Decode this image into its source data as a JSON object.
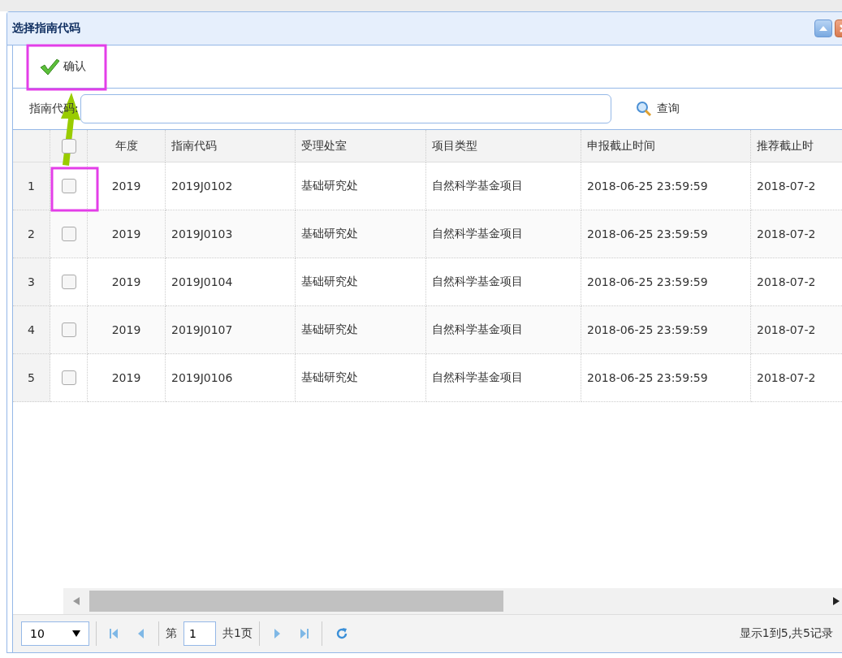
{
  "window": {
    "title": "选择指南代码"
  },
  "toolbar": {
    "confirm": "确认"
  },
  "search": {
    "label": "指南代码:",
    "button": "查询"
  },
  "table": {
    "columns": [
      "年度",
      "指南代码",
      "受理处室",
      "项目类型",
      "申报截止时间",
      "推荐截止时"
    ],
    "header_checked": false,
    "rows": [
      {
        "number": "1",
        "checked": false,
        "cells": [
          "2019",
          "2019J0102",
          "基础研究处",
          "自然科学基金项目",
          "2018-06-25 23:59:59",
          "2018-07-2"
        ]
      },
      {
        "number": "2",
        "checked": false,
        "cells": [
          "2019",
          "2019J0103",
          "基础研究处",
          "自然科学基金项目",
          "2018-06-25 23:59:59",
          "2018-07-2"
        ]
      },
      {
        "number": "3",
        "checked": false,
        "cells": [
          "2019",
          "2019J0104",
          "基础研究处",
          "自然科学基金项目",
          "2018-06-25 23:59:59",
          "2018-07-2"
        ]
      },
      {
        "number": "4",
        "checked": false,
        "cells": [
          "2019",
          "2019J0107",
          "基础研究处",
          "自然科学基金项目",
          "2018-06-25 23:59:59",
          "2018-07-2"
        ]
      },
      {
        "number": "5",
        "checked": false,
        "cells": [
          "2019",
          "2019J0106",
          "基础研究处",
          "自然科学基金项目",
          "2018-06-25 23:59:59",
          "2018-07-2"
        ]
      }
    ]
  },
  "pager": {
    "page_size": "10",
    "page_prefix": "第",
    "page": "1",
    "total_pages": "共1页",
    "summary": "显示1到5,共5记录"
  }
}
